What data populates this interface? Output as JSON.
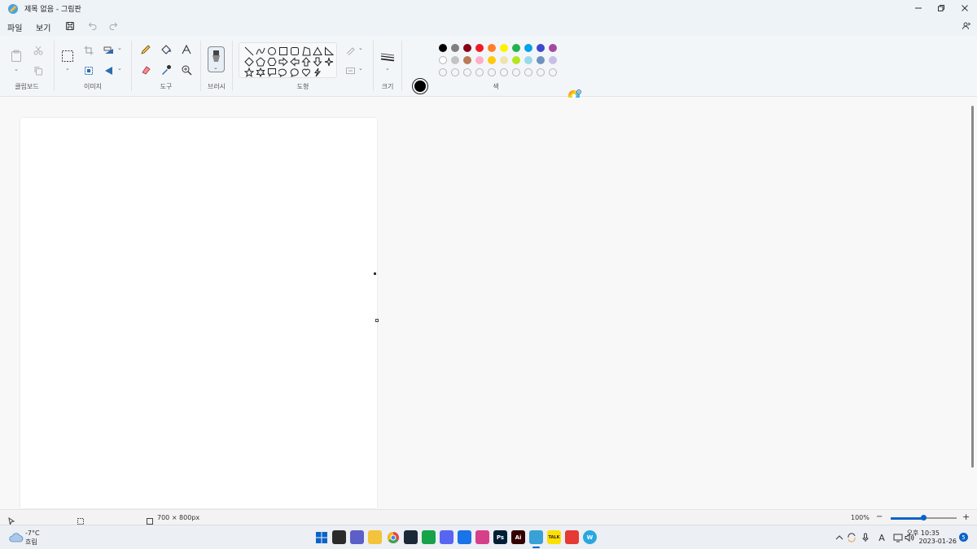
{
  "window": {
    "title": "제목 없음 - 그림판"
  },
  "menu": {
    "file": "파일",
    "view": "보기"
  },
  "ribbon": {
    "clipboard_label": "클립보드",
    "image_label": "이미지",
    "tools_label": "도구",
    "brush_label": "브러시",
    "shapes_label": "도형",
    "size_label": "크기",
    "colors_label": "색"
  },
  "colors": {
    "primary": "#000000",
    "secondary": "#ffffff",
    "row1": [
      "#000000",
      "#7f7f7f",
      "#880015",
      "#ed1c24",
      "#ff7f27",
      "#fff200",
      "#22b14c",
      "#00a2e8",
      "#3f48cc",
      "#a349a4"
    ],
    "row2": [
      "#ffffff",
      "#c3c3c3",
      "#b97a57",
      "#ffaec9",
      "#ffc90e",
      "#efe4b0",
      "#b5e61d",
      "#99d9ea",
      "#7092be",
      "#c8bfe7"
    ]
  },
  "status": {
    "canvas_size": "700 × 800px",
    "zoom": "100%",
    "zoom_level": 0.5
  },
  "taskbar": {
    "temperature": "-7°C",
    "weather": "흐림",
    "time": "오후 10:35",
    "date": "2023-01-26",
    "notification_count": "5"
  },
  "taskbar_apps": [
    {
      "name": "start",
      "color": "#0a64c8",
      "label": ""
    },
    {
      "name": "task-view",
      "color": "#2b2b2b",
      "label": ""
    },
    {
      "name": "teams",
      "color": "#5b5fc7",
      "label": ""
    },
    {
      "name": "file-explorer",
      "color": "#f3c33b",
      "label": ""
    },
    {
      "name": "chrome",
      "color": "#e8453c",
      "label": ""
    },
    {
      "name": "steam",
      "color": "#1b2838",
      "label": ""
    },
    {
      "name": "game-launcher",
      "color": "#17a34a",
      "label": ""
    },
    {
      "name": "discord",
      "color": "#5865f2",
      "label": ""
    },
    {
      "name": "bluetooth",
      "color": "#1a73e8",
      "label": ""
    },
    {
      "name": "camera",
      "color": "#d6408b",
      "label": ""
    },
    {
      "name": "photoshop",
      "color": "#001e36",
      "label": "Ps"
    },
    {
      "name": "illustrator",
      "color": "#330000",
      "label": "Ai"
    },
    {
      "name": "paint",
      "color": "#3aa0d8",
      "label": ""
    },
    {
      "name": "kakaotalk",
      "color": "#fae100",
      "label": "TALK"
    },
    {
      "name": "app-red",
      "color": "#e53935",
      "label": ""
    },
    {
      "name": "app-w",
      "color": "#2aa7e0",
      "label": "W"
    }
  ]
}
